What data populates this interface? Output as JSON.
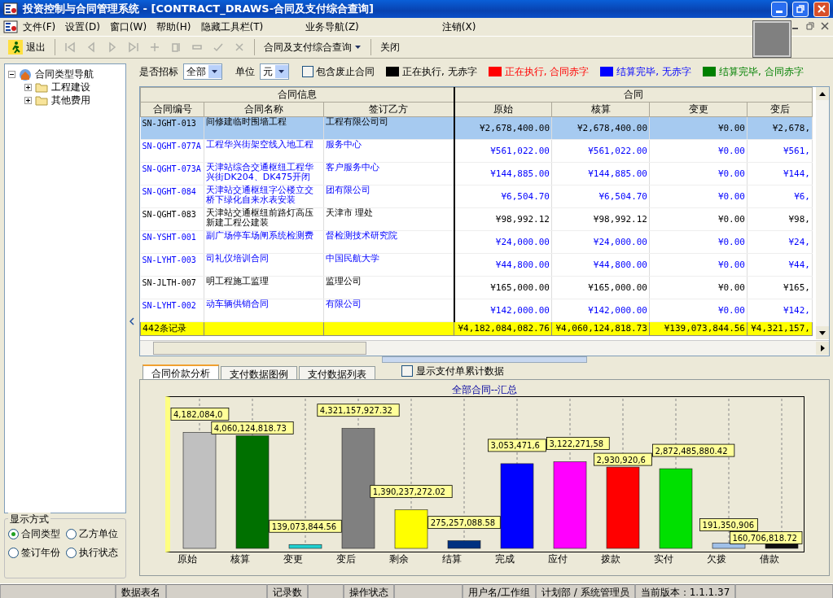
{
  "window": {
    "title": "投资控制与合同管理系统 - [CONTRACT_DRAWS-合同及支付综合查询]"
  },
  "menu": [
    {
      "label": "文件(F)"
    },
    {
      "label": "设置(D)"
    },
    {
      "label": "窗口(W)"
    },
    {
      "label": "帮助(H)"
    },
    {
      "label": "隐藏工具栏(T)"
    },
    {
      "label": "业务导航(Z)"
    },
    {
      "label": "注销(X)"
    }
  ],
  "toolbar": {
    "exit": "退出",
    "nav_buttons": [
      {
        "kind": "first",
        "disabled": true
      },
      {
        "kind": "prev",
        "disabled": true
      },
      {
        "kind": "next",
        "disabled": true
      },
      {
        "kind": "last",
        "disabled": true
      },
      {
        "kind": "add",
        "disabled": true
      },
      {
        "kind": "copy",
        "disabled": true
      },
      {
        "kind": "minus",
        "disabled": true
      },
      {
        "kind": "check",
        "disabled": true
      },
      {
        "kind": "cancel",
        "disabled": true
      }
    ],
    "view_dropdown": "合同及支付综合查询",
    "close": "关闭"
  },
  "tree": {
    "label": "合同类型导航",
    "expanded": true,
    "children": [
      {
        "label": "工程建设",
        "expanded": false
      },
      {
        "label": "其他费用",
        "expanded": false
      }
    ]
  },
  "display_mode": {
    "title": "显示方式",
    "options": [
      {
        "label": "合同类型",
        "selected": true
      },
      {
        "label": "乙方单位",
        "selected": false
      },
      {
        "label": "签订年份",
        "selected": false
      },
      {
        "label": "执行状态",
        "selected": false
      }
    ]
  },
  "filters": {
    "bid_label": "是否招标",
    "bid_value": "全部",
    "unit_label": "单位",
    "unit_value": "元",
    "include_void": {
      "label": "包含废止合同",
      "checked": false
    }
  },
  "legend": [
    {
      "label": "正在执行, 无赤字",
      "color": "#000000"
    },
    {
      "label": "正在执行, 合同赤字",
      "color": "#ff0000"
    },
    {
      "label": "结算完毕, 无赤字",
      "color": "#0000ff"
    },
    {
      "label": "结算完毕, 合同赤字",
      "color": "#008000"
    }
  ],
  "table": {
    "groups": [
      {
        "label": "合同信息"
      },
      {
        "label": "合同"
      }
    ],
    "columns": [
      "合同编号",
      "合同名称",
      "签订乙方",
      "原始",
      "核算",
      "变更",
      "变后"
    ],
    "rows": [
      {
        "selected": true,
        "kind": "executing",
        "cells": [
          "SN-JGHT-013",
          "间修建临时围墙工程",
          "工程有限公司司",
          "¥2,678,400.00",
          "¥2,678,400.00",
          "¥0.00",
          "¥2,678,"
        ]
      },
      {
        "selected": false,
        "kind": "settled",
        "cells": [
          "SN-QGHT-077A",
          "工程华兴街架空线入地工程",
          "服务中心",
          "¥561,022.00",
          "¥561,022.00",
          "¥0.00",
          "¥561,"
        ]
      },
      {
        "selected": false,
        "kind": "settled",
        "cells": [
          "SN-QGHT-073A",
          "天津站综合交通枢纽工程华兴街DK204、DK475开闭",
          "客户服务中心",
          "¥144,885.00",
          "¥144,885.00",
          "¥0.00",
          "¥144,"
        ]
      },
      {
        "selected": false,
        "kind": "settled",
        "cells": [
          "SN-QGHT-084",
          "天津站交通枢纽字公楼立交桥下绿化自来水表安装",
          "团有限公司",
          "¥6,504.70",
          "¥6,504.70",
          "¥0.00",
          "¥6,"
        ]
      },
      {
        "selected": false,
        "kind": "executing",
        "cells": [
          "SN-QGHT-083",
          "天津站交通枢纽前路灯高压新建工程公建装",
          "天津市 理处",
          "¥98,992.12",
          "¥98,992.12",
          "¥0.00",
          "¥98,"
        ]
      },
      {
        "selected": false,
        "kind": "settled",
        "cells": [
          "SN-YSHT-001",
          "副广场停车场闸系统检测费",
          "督检测技术研究院",
          "¥24,000.00",
          "¥24,000.00",
          "¥0.00",
          "¥24,"
        ]
      },
      {
        "selected": false,
        "kind": "settled",
        "cells": [
          "SN-LYHT-003",
          "司礼仪培训合同",
          "中国民航大学",
          "¥44,800.00",
          "¥44,800.00",
          "¥0.00",
          "¥44,"
        ]
      },
      {
        "selected": false,
        "kind": "executing",
        "cells": [
          "SN-JLTH-007",
          "明工程施工监理",
          "监理公司",
          "¥165,000.00",
          "¥165,000.00",
          "¥0.00",
          "¥165,"
        ]
      },
      {
        "selected": false,
        "kind": "settled",
        "cells": [
          "SN-LYHT-002",
          "动车辆供销合同",
          "有限公司",
          "¥142,000.00",
          "¥142,000.00",
          "¥0.00",
          "¥142,"
        ]
      }
    ],
    "totals": {
      "label": "442条记录",
      "amounts": [
        "¥4,182,084,082.76",
        "¥4,060,124,818.73",
        "¥139,073,844.56",
        "¥4,321,157,"
      ]
    }
  },
  "tabs": [
    {
      "label": "合同价款分析",
      "selected": true
    },
    {
      "label": "支付数据图例",
      "selected": false
    },
    {
      "label": "支付数据列表",
      "selected": false
    }
  ],
  "cumulative": {
    "label": "显示支付单累计数据",
    "checked": false
  },
  "chart_data": {
    "type": "bar",
    "title": "全部合同--汇总",
    "grid": true,
    "categories": [
      "原始",
      "核算",
      "变更",
      "变后",
      "剩余",
      "结算",
      "完成",
      "应付",
      "拨款",
      "实付",
      "欠拨",
      "借款"
    ],
    "values": [
      4182084082.76,
      4060124818.73,
      139073844.56,
      4321157927.32,
      1390237272.02,
      275257088.58,
      3053471680,
      3122271580,
      2930920600,
      2872485880.42,
      191350906,
      160706818.72
    ],
    "value_labels": [
      "4,182,084,0",
      "4,060,124,818.73",
      "139,073,844.56",
      "4,321,157,927.32",
      "1,390,237,272.02",
      "275,257,088.58",
      "3,053,471,6",
      "3,122,271,58",
      "2,930,920,6",
      "2,872,485,880.42",
      "191,350,906",
      "160,706,818.72"
    ]
  },
  "status_bar": [
    "数据表名",
    "记录数",
    "操作状态",
    "用户名/工作组",
    "计划部 / 系统管理员",
    "当前版本：1.1.1.37"
  ]
}
